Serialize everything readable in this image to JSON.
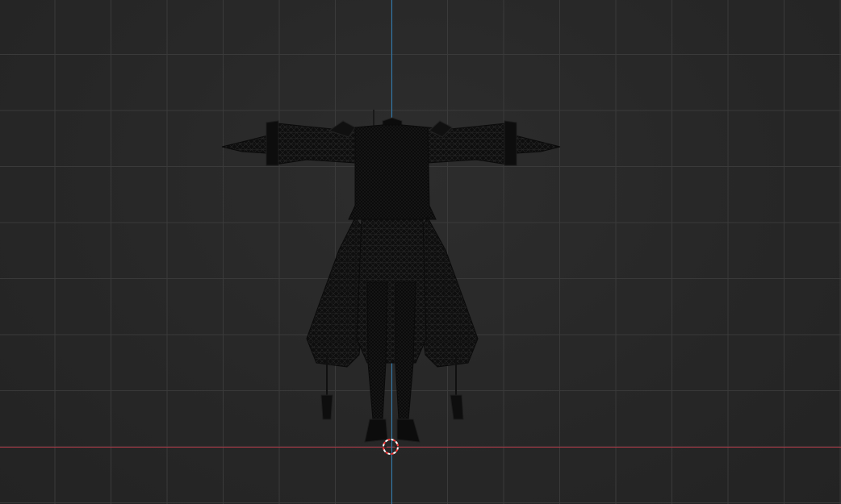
{
  "viewport": {
    "background_color": "#262626",
    "grid_color": "#3a3a3a",
    "x_axis_color": "#b23a48",
    "y_axis_color": "#2f7db3",
    "wireframe_color": "#0c0c0c",
    "wireframe_line_color": "#2a2a2a"
  },
  "cursor": {
    "icon": "3d-cursor-icon",
    "ring_color_a": "#ff3a3a",
    "ring_color_b": "#ffffff"
  },
  "model": {
    "icon": "character-wireframe-icon",
    "pose": "T-pose"
  }
}
